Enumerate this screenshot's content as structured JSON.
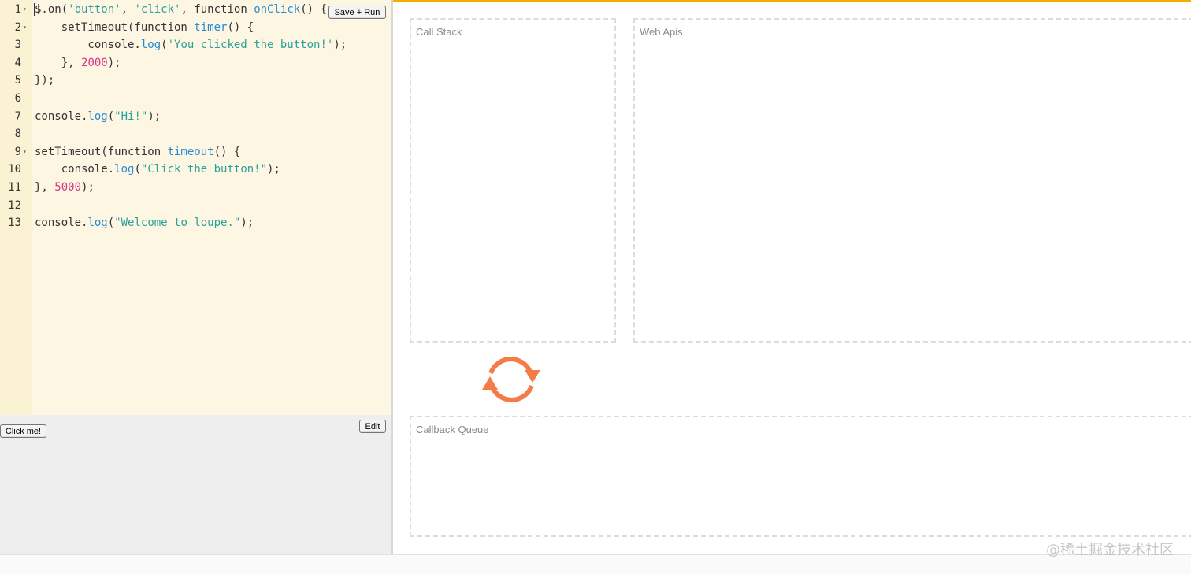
{
  "editor": {
    "run_label": "Save + Run",
    "lines": [
      {
        "n": "1",
        "fold": true
      },
      {
        "n": "2",
        "fold": true
      },
      {
        "n": "3",
        "fold": false
      },
      {
        "n": "4",
        "fold": false
      },
      {
        "n": "5",
        "fold": false
      },
      {
        "n": "6",
        "fold": false
      },
      {
        "n": "7",
        "fold": false
      },
      {
        "n": "8",
        "fold": false
      },
      {
        "n": "9",
        "fold": true
      },
      {
        "n": "10",
        "fold": false
      },
      {
        "n": "11",
        "fold": false
      },
      {
        "n": "12",
        "fold": false
      },
      {
        "n": "13",
        "fold": false
      }
    ],
    "code": {
      "l1": {
        "a": "$.on(",
        "s1": "'button'",
        "b": ", ",
        "s2": "'click'",
        "c": ", function ",
        "fn": "onClick",
        "d": "() {"
      },
      "l2": {
        "a": "    setTimeout(function ",
        "fn": "timer",
        "d": "() {"
      },
      "l3": {
        "a": "        console.",
        "fn": "log",
        "b": "(",
        "s": "'You clicked the button!'",
        "c": ");"
      },
      "l4": {
        "a": "    }, ",
        "num": "2000",
        "c": ");"
      },
      "l5": {
        "a": "});"
      },
      "l7": {
        "a": "console.",
        "fn": "log",
        "b": "(",
        "s": "\"Hi!\"",
        "c": ");"
      },
      "l9": {
        "a": "setTimeout(function ",
        "fn": "timeout",
        "d": "() {"
      },
      "l10": {
        "a": "    console.",
        "fn": "log",
        "b": "(",
        "s": "\"Click the button!\"",
        "c": ");"
      },
      "l11": {
        "a": "}, ",
        "num": "5000",
        "c": ");"
      },
      "l13": {
        "a": "console.",
        "fn": "log",
        "b": "(",
        "s": "\"Welcome to loupe.\"",
        "c": ");"
      }
    }
  },
  "output": {
    "click_label": "Click me!",
    "edit_label": "Edit"
  },
  "panels": {
    "call_stack": "Call Stack",
    "web_apis": "Web Apis",
    "callback_queue": "Callback Queue"
  },
  "colors": {
    "loop_arrow": "#f47c48",
    "accent_line": "#f0b000"
  },
  "watermark": "@稀土掘金技术社区"
}
